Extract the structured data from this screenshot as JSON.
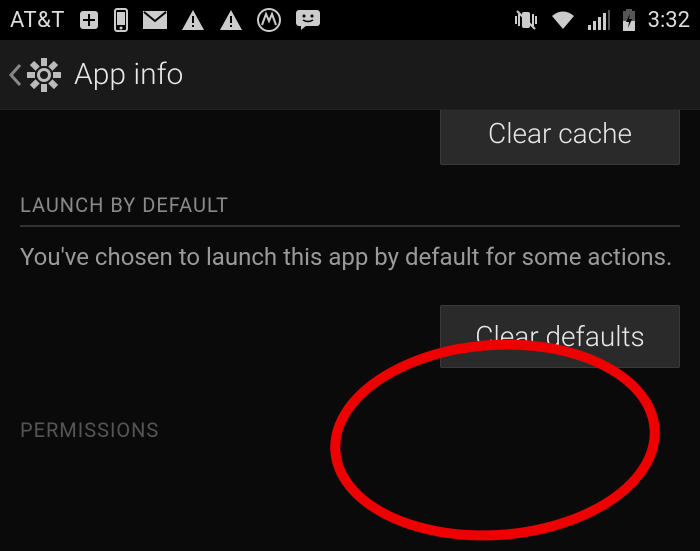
{
  "status_bar": {
    "carrier": "AT&T",
    "time": "3:32",
    "icons": {
      "plus": "plus-box",
      "phone": "phone",
      "gmail": "gmail",
      "warning1": "warning",
      "warning2": "warning",
      "motorola": "motorola",
      "message": "message-smile",
      "mute": "vibrate-mute",
      "wifi": "wifi",
      "signal": "cell-signal",
      "battery": "battery-charging"
    }
  },
  "header": {
    "title": "App info"
  },
  "main": {
    "clear_cache_label": "Clear cache",
    "launch_section_header": "LAUNCH BY DEFAULT",
    "launch_section_body": "You've chosen to launch this app by default for some actions.",
    "clear_defaults_label": "Clear defaults",
    "permissions_header_partial": "PERMISSIONS"
  }
}
